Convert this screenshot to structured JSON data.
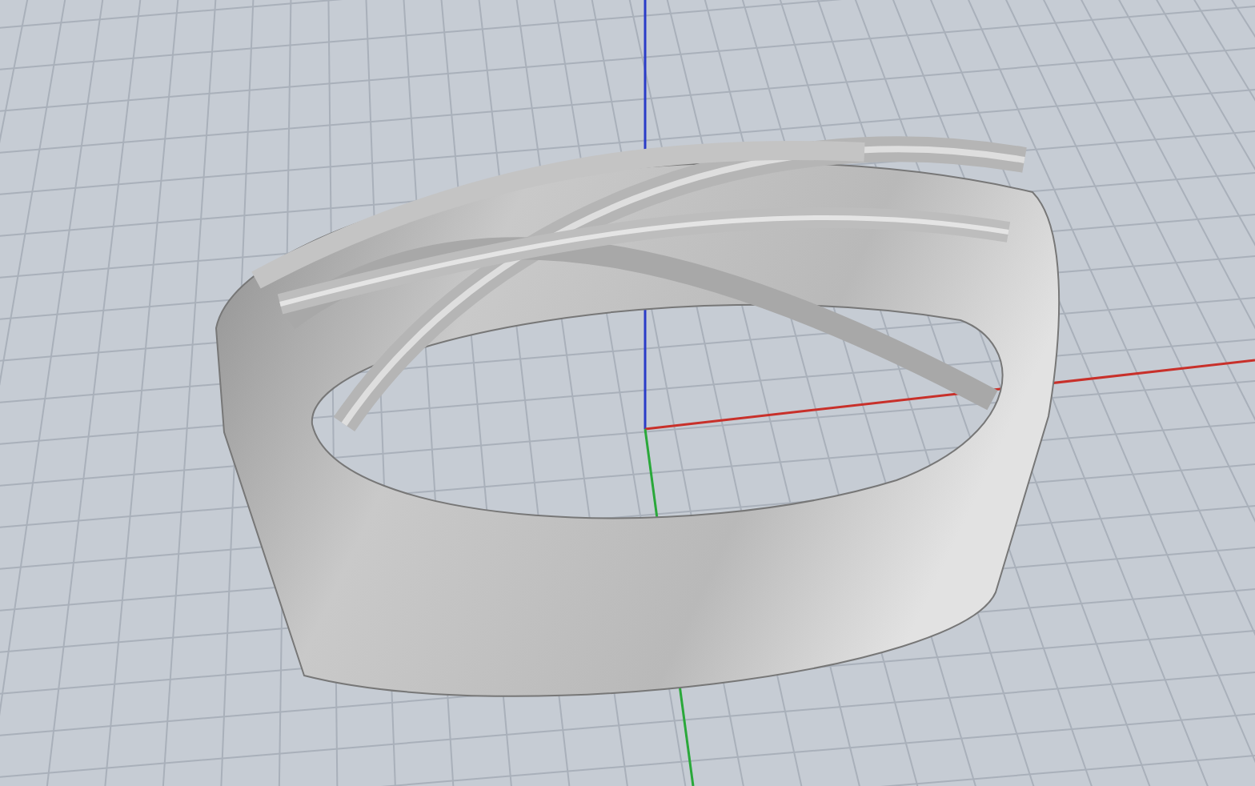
{
  "viewport": {
    "show_grid": true,
    "show_axes": true
  }
}
